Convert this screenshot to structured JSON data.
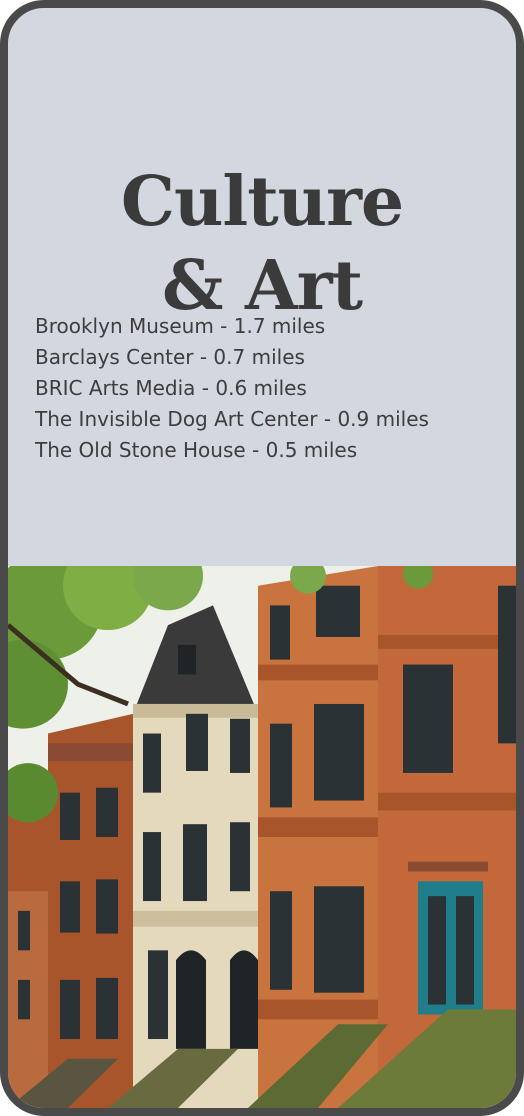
{
  "title_line1": "Culture",
  "title_line2": "& Art",
  "places": [
    {
      "text": "Brooklyn Museum - 1.7 miles"
    },
    {
      "text": "Barclays Center - 0.7 miles"
    },
    {
      "text": "BRIC Arts Media - 0.6 miles"
    },
    {
      "text": "The Invisible Dog Art Center - 0.9 miles"
    },
    {
      "text": "The Old Stone House - 0.5 miles"
    }
  ],
  "photo": {
    "subject": "brownstone rowhouses",
    "colors": {
      "brick": "#c9743f",
      "brick_dark": "#a9552c",
      "limestone": "#e4d8bd",
      "brownstone": "#8b4b33",
      "door": "#1f7e8a",
      "foliage": "#6b9a3a",
      "window": "#2b3236"
    }
  }
}
